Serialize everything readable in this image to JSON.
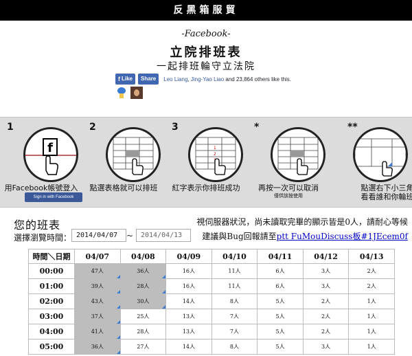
{
  "topbar": {
    "title": "反黑箱服貿"
  },
  "header": {
    "fb_label": "-Facebook-",
    "title": "立院排班表",
    "subtitle": "一起排班輪守立法院"
  },
  "facebook": {
    "like_label": "Like",
    "share_label": "Share",
    "friend1": "Leo Liang",
    "friend2": "Jing-Yao Liao",
    "rest": " and 23,864 others like this."
  },
  "steps": [
    {
      "num": "1",
      "caption": "用Facebook帳號登入",
      "button": "Sign in with Facebook"
    },
    {
      "num": "2",
      "caption": "點選表格就可以排班"
    },
    {
      "num": "3",
      "caption": "紅字表示你排班成功"
    },
    {
      "num": "*",
      "caption": "再按一次可以取消",
      "note": "僅供該按使用"
    },
    {
      "num": "**",
      "caption": "點選右下小三角",
      "caption2": "看看誰和你輪班"
    }
  ],
  "schedule": {
    "heading": "您的班表",
    "notice": "視伺服器狀況，尚未讀取完畢的顯示皆是0人，請耐心等候",
    "select_label": "選擇瀏覽時間：",
    "date_from": "2014/04/07",
    "tilde": "~",
    "date_to": "2014/04/13",
    "bug_text": "建議與Bug回報請至",
    "bug_link": "ptt FuMouDiscuss板#1JEcem0f",
    "corner_header": "時間＼日期",
    "dates": [
      "04/07",
      "04/08",
      "04/09",
      "04/10",
      "04/11",
      "04/12",
      "04/13"
    ],
    "rows": [
      {
        "time": "00:00",
        "cells": [
          "47人",
          "36人",
          "16人",
          "11人",
          "6人",
          "3人",
          "2人"
        ],
        "filled": [
          true,
          true,
          false,
          false,
          false,
          false,
          false
        ]
      },
      {
        "time": "01:00",
        "cells": [
          "39人",
          "28人",
          "16人",
          "11人",
          "6人",
          "3人",
          "2人"
        ],
        "filled": [
          true,
          true,
          false,
          false,
          false,
          false,
          false
        ]
      },
      {
        "time": "02:00",
        "cells": [
          "43人",
          "30人",
          "14人",
          "8人",
          "5人",
          "2人",
          "1人"
        ],
        "filled": [
          true,
          true,
          false,
          false,
          false,
          false,
          false
        ]
      },
      {
        "time": "03:00",
        "cells": [
          "37人",
          "25人",
          "13人",
          "7人",
          "5人",
          "2人",
          "1人"
        ],
        "filled": [
          true,
          false,
          false,
          false,
          false,
          false,
          false
        ]
      },
      {
        "time": "04:00",
        "cells": [
          "41人",
          "28人",
          "13人",
          "7人",
          "5人",
          "2人",
          "1人"
        ],
        "filled": [
          true,
          false,
          false,
          false,
          false,
          false,
          false
        ]
      },
      {
        "time": "05:00",
        "cells": [
          "36人",
          "27人",
          "14人",
          "8人",
          "5人",
          "3人",
          "1人"
        ],
        "filled": [
          true,
          false,
          false,
          false,
          false,
          false,
          false
        ]
      }
    ]
  },
  "colors": {
    "topbar": "#000000",
    "fb_blue": "#4267b2",
    "steps_bg": "#dcdcdc",
    "filled_cell": "#bdbdbd",
    "corner_tri": "#3b7bd4",
    "link": "#0000cc"
  }
}
